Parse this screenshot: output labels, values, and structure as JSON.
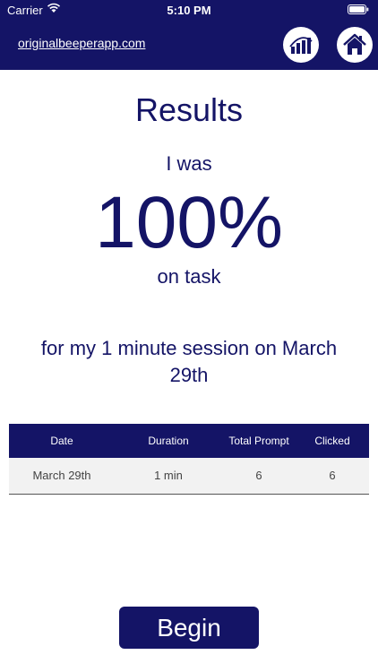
{
  "status_bar": {
    "carrier": "Carrier",
    "time": "5:10 PM"
  },
  "header": {
    "site_link": "originalbeeperapp.com",
    "background_color": "#141466",
    "stats_icon": "bar-chart-icon",
    "home_icon": "home-icon"
  },
  "results": {
    "title": "Results",
    "pre_text": "I was",
    "percent": "100%",
    "post_text": "on task",
    "session_text": "for my 1 minute session on March 29th"
  },
  "table": {
    "headers": [
      "Date",
      "Duration",
      "Total Prompt",
      "Clicked"
    ],
    "rows": [
      [
        "March 29th",
        "1 min",
        "6",
        "6"
      ]
    ]
  },
  "actions": {
    "begin_label": "Begin"
  }
}
